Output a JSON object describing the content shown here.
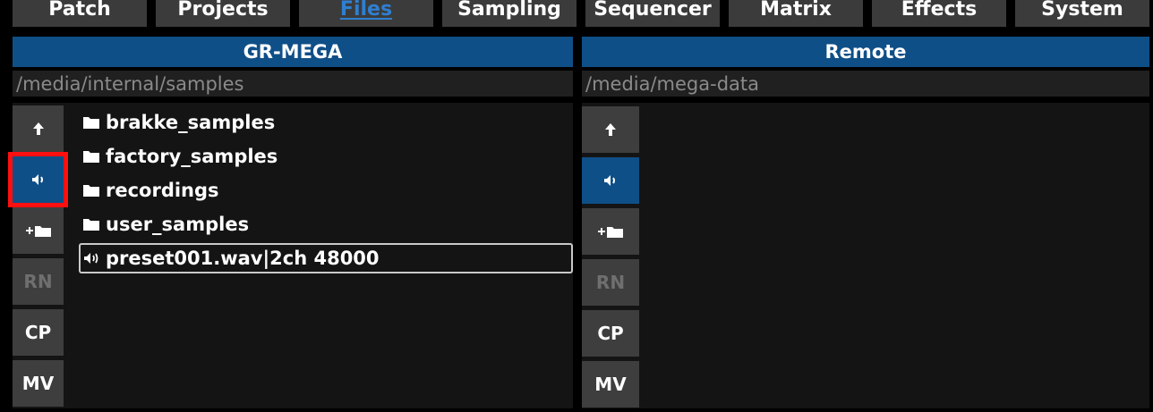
{
  "tabs": [
    {
      "label": "Patch"
    },
    {
      "label": "Projects"
    },
    {
      "label": "Files"
    },
    {
      "label": "Sampling"
    },
    {
      "label": "Sequencer"
    },
    {
      "label": "Matrix"
    },
    {
      "label": "Effects"
    },
    {
      "label": "System"
    }
  ],
  "active_tab": "Files",
  "left": {
    "title": "GR-MEGA",
    "path": "/media/internal/samples",
    "buttons": {
      "rename": "RN",
      "copy": "CP",
      "move": "MV"
    },
    "items": [
      {
        "name": "brakke_samples",
        "icon": "folder-icon"
      },
      {
        "name": "factory_samples",
        "icon": "folder-icon"
      },
      {
        "name": "recordings",
        "icon": "folder-icon"
      },
      {
        "name": "user_samples",
        "icon": "folder-icon"
      },
      {
        "name": "preset001.wav|2ch 48000",
        "icon": "speaker-icon"
      }
    ]
  },
  "right": {
    "title": "Remote",
    "path": "/media/mega-data",
    "buttons": {
      "rename": "RN",
      "copy": "CP",
      "move": "MV"
    }
  },
  "colors": {
    "accent": "#0f4f87",
    "active_tab": "#2f7fd0",
    "highlight": "#ff1010"
  }
}
